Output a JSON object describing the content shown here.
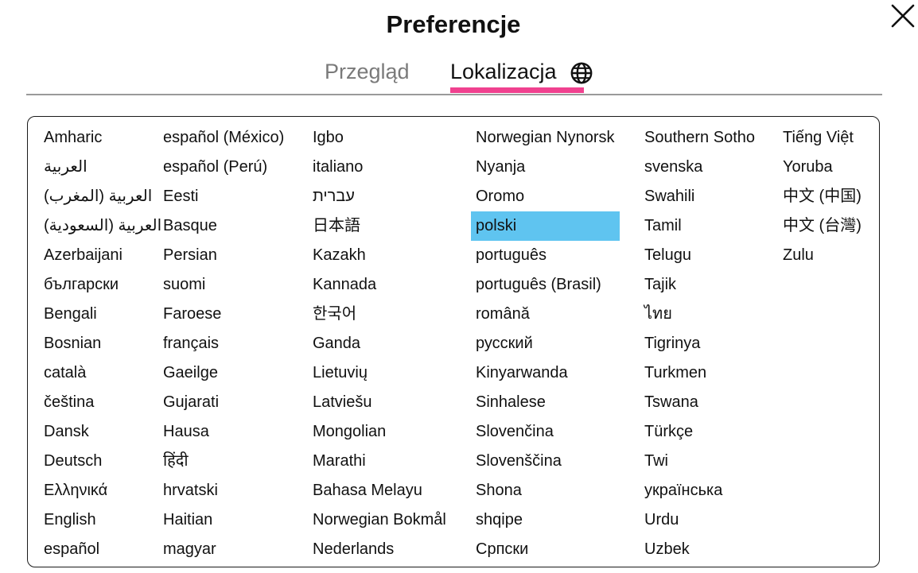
{
  "dialog": {
    "title": "Preferencje",
    "close_icon": "close-icon"
  },
  "tabs": [
    {
      "label": "Przegląd",
      "active": false
    },
    {
      "label": "Lokalizacja",
      "active": true,
      "icon": "globe-icon"
    }
  ],
  "colors": {
    "active_tab_underline": "#f0418f",
    "selected_language_bg": "#5fc4f0",
    "inactive_tab_text": "#7a7a7a"
  },
  "selected_language": "polski",
  "languages": {
    "columns": [
      [
        "Amharic",
        "العربية",
        "العربية (المغرب)",
        "العربية (السعودية)",
        "Azerbaijani",
        "български",
        "Bengali",
        "Bosnian",
        "català",
        "čeština",
        "Dansk",
        "Deutsch",
        "Ελληνικά",
        "English",
        "español"
      ],
      [
        "español (México)",
        "español (Perú)",
        "Eesti",
        "Basque",
        "Persian",
        "suomi",
        "Faroese",
        "français",
        "Gaeilge",
        "Gujarati",
        "Hausa",
        "हिंदी",
        "hrvatski",
        "Haitian",
        "magyar"
      ],
      [
        "Igbo",
        "italiano",
        "עברית",
        "日本語",
        "Kazakh",
        "Kannada",
        "한국어",
        "Ganda",
        "Lietuvių",
        "Latviešu",
        "Mongolian",
        "Marathi",
        "Bahasa Melayu",
        "Norwegian Bokmål",
        "Nederlands"
      ],
      [
        "Norwegian Nynorsk",
        "Nyanja",
        "Oromo",
        "polski",
        "português",
        "português (Brasil)",
        "română",
        "русский",
        "Kinyarwanda",
        "Sinhalese",
        "Slovenčina",
        "Slovenščina",
        "Shona",
        "shqipe",
        "Српски"
      ],
      [
        "Southern Sotho",
        "svenska",
        "Swahili",
        "Tamil",
        "Telugu",
        "Tajik",
        "ไทย",
        "Tigrinya",
        "Turkmen",
        "Tswana",
        "Türkçe",
        "Twi",
        "українська",
        "Urdu",
        "Uzbek"
      ],
      [
        "Tiếng Việt",
        "Yoruba",
        "中文 (中国)",
        "中文 (台灣)",
        "Zulu"
      ]
    ]
  }
}
